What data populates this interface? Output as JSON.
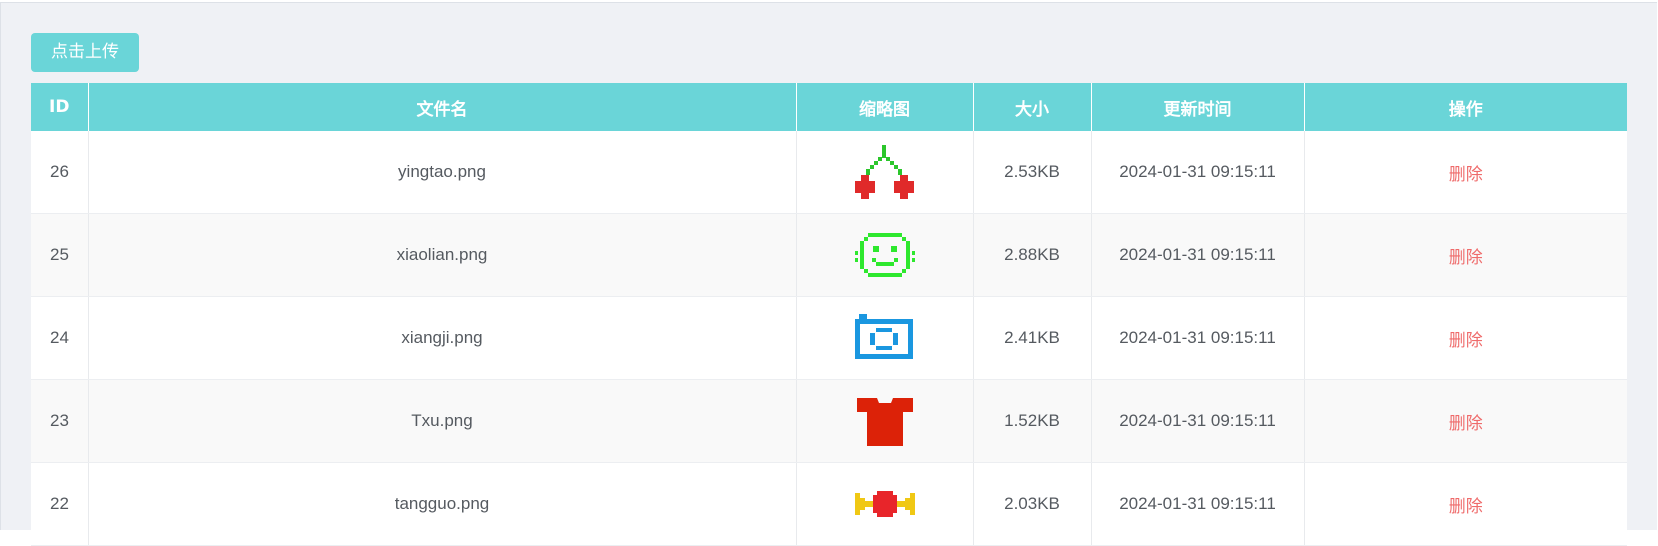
{
  "upload_button": {
    "label": "点击上传"
  },
  "table": {
    "columns": [
      "ID",
      "文件名",
      "缩略图",
      "大小",
      "更新时间",
      "操作"
    ],
    "rows": [
      {
        "id": "26",
        "filename": "yingtao.png",
        "thumbnail": "cherry-icon",
        "size": "2.53KB",
        "updated": "2024-01-31 09:15:11",
        "action": "删除"
      },
      {
        "id": "25",
        "filename": "xiaolian.png",
        "thumbnail": "smiley-face-icon",
        "size": "2.88KB",
        "updated": "2024-01-31 09:15:11",
        "action": "删除"
      },
      {
        "id": "24",
        "filename": "xiangji.png",
        "thumbnail": "camera-icon",
        "size": "2.41KB",
        "updated": "2024-01-31 09:15:11",
        "action": "删除"
      },
      {
        "id": "23",
        "filename": "Txu.png",
        "thumbnail": "t-shirt-icon",
        "size": "1.52KB",
        "updated": "2024-01-31 09:15:11",
        "action": "删除"
      },
      {
        "id": "22",
        "filename": "tangguo.png",
        "thumbnail": "candy-icon",
        "size": "2.03KB",
        "updated": "2024-01-31 09:15:11",
        "action": "删除"
      }
    ]
  },
  "colors": {
    "accent": "#6ad5d8",
    "delete_link": "#ef6b6b",
    "cherry_fruit": "#e02a2a",
    "cherry_stem": "#2bc62b",
    "smiley": "#2ee82e",
    "camera": "#1a97e0",
    "t_shirt": "#dc2208",
    "candy_body": "#e8252a",
    "candy_wrapper": "#f0c814"
  }
}
